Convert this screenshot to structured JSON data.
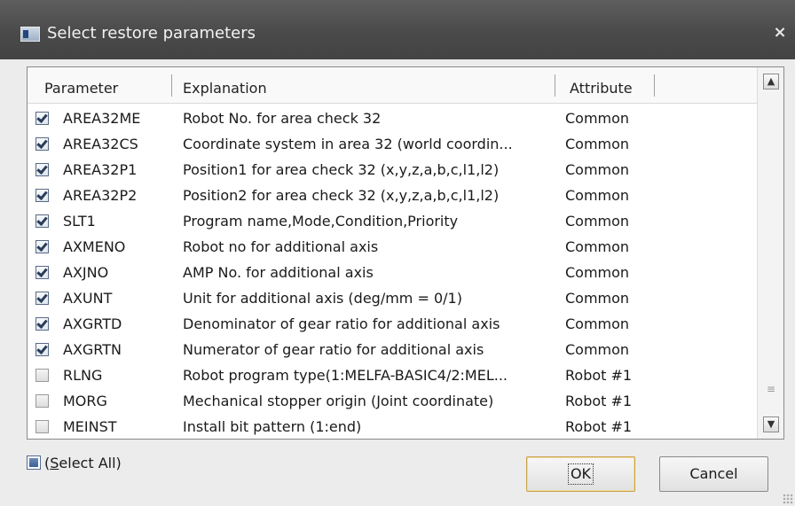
{
  "window": {
    "title": "Select restore parameters",
    "close_glyph": "×"
  },
  "grid": {
    "columns": [
      "Parameter",
      "Explanation",
      "Attribute"
    ],
    "rows": [
      {
        "checked": true,
        "param": "AREA32ME",
        "explanation": "Robot No. for area check 32",
        "attribute": "Common"
      },
      {
        "checked": true,
        "param": "AREA32CS",
        "explanation": "Coordinate system in area 32 (world coordin...",
        "attribute": "Common"
      },
      {
        "checked": true,
        "param": "AREA32P1",
        "explanation": "Position1 for area check 32 (x,y,z,a,b,c,l1,l2)",
        "attribute": "Common"
      },
      {
        "checked": true,
        "param": "AREA32P2",
        "explanation": "Position2 for area check 32 (x,y,z,a,b,c,l1,l2)",
        "attribute": "Common"
      },
      {
        "checked": true,
        "param": "SLT1",
        "explanation": "Program name,Mode,Condition,Priority",
        "attribute": "Common"
      },
      {
        "checked": true,
        "param": "AXMENO",
        "explanation": "Robot no for additional axis",
        "attribute": "Common"
      },
      {
        "checked": true,
        "param": "AXJNO",
        "explanation": "AMP No. for additional axis",
        "attribute": "Common"
      },
      {
        "checked": true,
        "param": "AXUNT",
        "explanation": "Unit for additional axis (deg/mm = 0/1)",
        "attribute": "Common"
      },
      {
        "checked": true,
        "param": "AXGRTD",
        "explanation": "Denominator of gear ratio for additional axis",
        "attribute": "Common"
      },
      {
        "checked": true,
        "param": "AXGRTN",
        "explanation": "Numerator of gear ratio for additional axis",
        "attribute": "Common"
      },
      {
        "checked": false,
        "param": "RLNG",
        "explanation": "Robot program type(1:MELFA-BASIC4/2:MEL...",
        "attribute": "Robot #1"
      },
      {
        "checked": false,
        "param": "MORG",
        "explanation": "Mechanical stopper origin (Joint coordinate)",
        "attribute": "Robot #1"
      },
      {
        "checked": false,
        "param": "MEINST",
        "explanation": "Install bit pattern (1:end)",
        "attribute": "Robot #1"
      }
    ]
  },
  "select_all": {
    "label_prefix": "(",
    "label_accel": "S",
    "label_rest": "elect All)",
    "checked": "partial"
  },
  "buttons": {
    "ok": "OK",
    "cancel": "Cancel"
  },
  "icons": {
    "app": "app-window-icon",
    "scroll_up": "▲",
    "scroll_down": "▼",
    "scroll_grip": "≡"
  },
  "colors": {
    "titlebar": "#4a4a4a",
    "dialog_bg": "#ececec",
    "ok_border": "#c8a24a",
    "check": "#2b3d58"
  }
}
